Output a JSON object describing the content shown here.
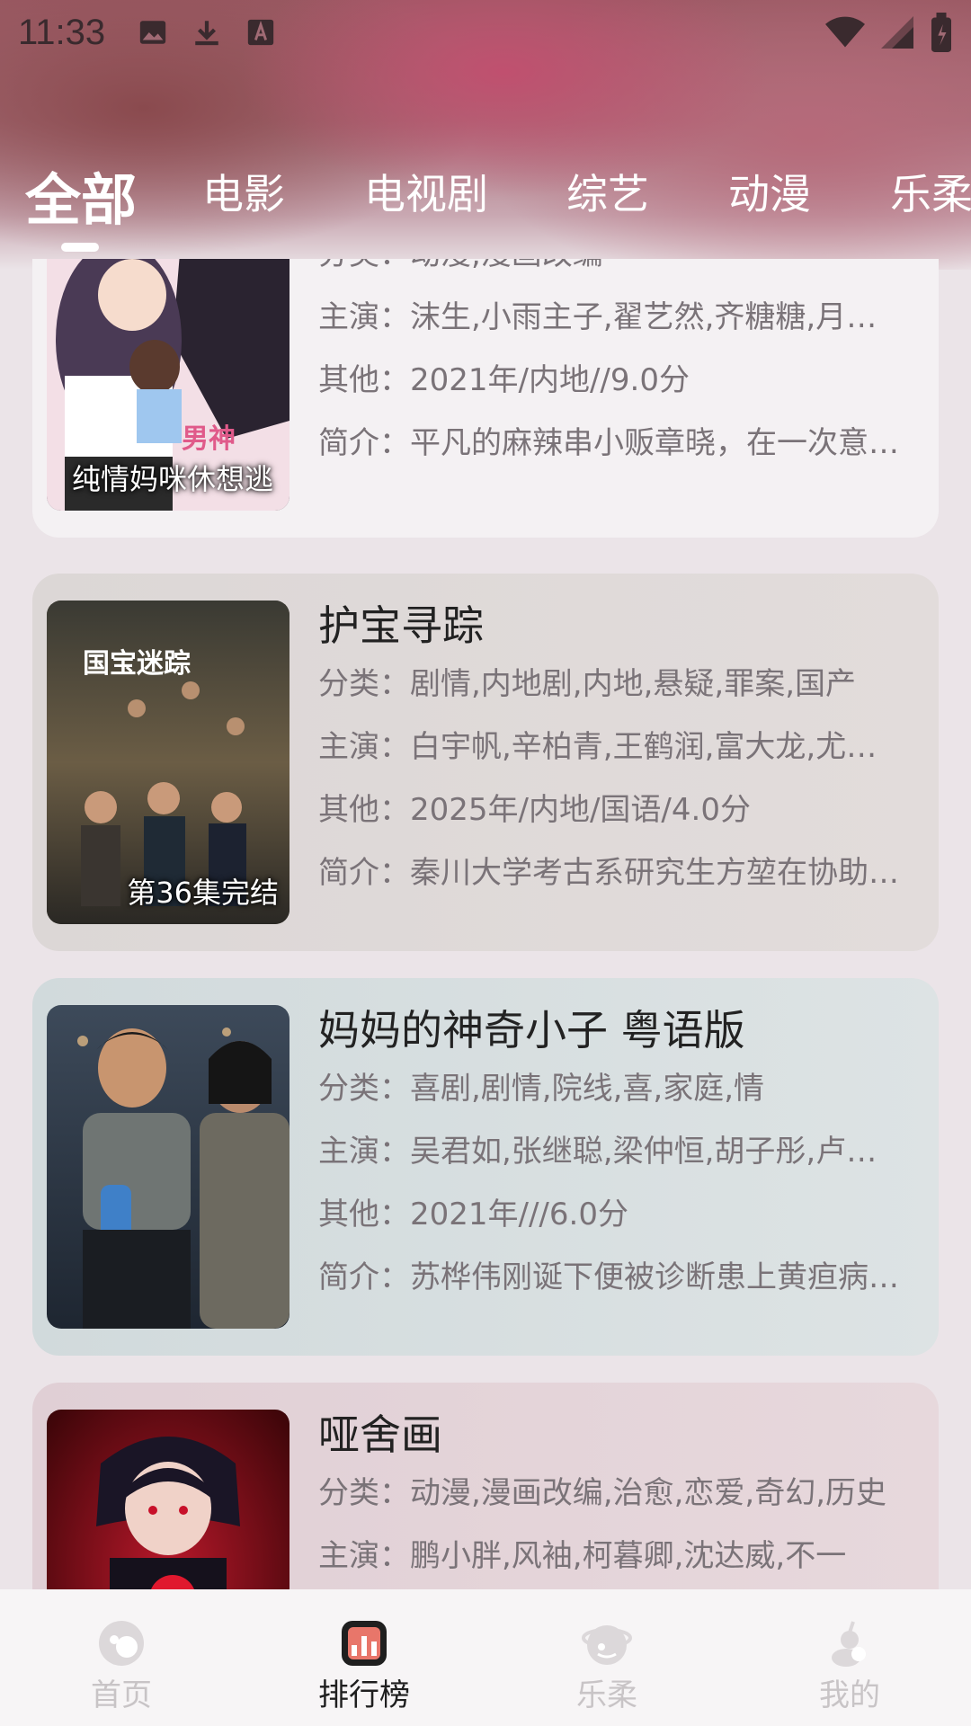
{
  "status_bar": {
    "time": "11:33",
    "icons_left": [
      "image-icon",
      "download-icon",
      "font-icon"
    ],
    "icons_right": [
      "wifi-icon",
      "signal-icon",
      "battery-icon"
    ]
  },
  "tabs": [
    {
      "label": "全部",
      "active": true
    },
    {
      "label": "电影",
      "active": false
    },
    {
      "label": "电视剧",
      "active": false
    },
    {
      "label": "综艺",
      "active": false
    },
    {
      "label": "动漫",
      "active": false
    },
    {
      "label": "乐柔",
      "active": false
    }
  ],
  "cards": [
    {
      "title": "",
      "poster_label": "纯情妈咪休想逃",
      "category_label": "分类：",
      "category": "动漫,漫画改编",
      "cast_label": "主演：",
      "cast": "沫生,小雨主子,翟艺然,齐糖糖,月…",
      "other_label": "其他：",
      "other": "2021年/内地//9.0分",
      "intro_label": "简介：",
      "intro": "平凡的麻辣串小贩章晓，在一次意…"
    },
    {
      "title": "护宝寻踪",
      "poster_label": "第36集完结",
      "poster_text": "国宝迷踪",
      "category_label": "分类：",
      "category": "剧情,内地剧,内地,悬疑,罪案,国产",
      "cast_label": "主演：",
      "cast": "白宇帆,辛柏青,王鹤润,富大龙,尤…",
      "other_label": "其他：",
      "other": "2025年/内地/国语/4.0分",
      "intro_label": "简介：",
      "intro": "秦川大学考古系研究生方堃在协助…"
    },
    {
      "title": "妈妈的神奇小子 粤语版",
      "poster_label": "",
      "category_label": "分类：",
      "category": "喜剧,剧情,院线,喜,家庭,情",
      "cast_label": "主演：",
      "cast": "吴君如,张继聪,梁仲恒,胡子彤,卢…",
      "other_label": "其他：",
      "other": "2021年///6.0分",
      "intro_label": "简介：",
      "intro": "苏桦伟刚诞下便被诊断患上黄疸病…"
    },
    {
      "title": "哑舍画",
      "poster_label": "",
      "category_label": "分类：",
      "category": "动漫,漫画改编,治愈,恋爱,奇幻,历史",
      "cast_label": "主演：",
      "cast": "鹏小胖,风袖,柯暮卿,沈达威,不一"
    }
  ],
  "bottom_nav": [
    {
      "label": "首页",
      "icon": "home-icon",
      "active": false
    },
    {
      "label": "排行榜",
      "icon": "ranking-icon",
      "active": true
    },
    {
      "label": "乐柔",
      "icon": "planet-icon",
      "active": false
    },
    {
      "label": "我的",
      "icon": "profile-icon",
      "active": false
    }
  ],
  "colors": {
    "active_nav": "#1f1f1f",
    "inactive_nav": "#c8c4c6",
    "ranking_icon": "#e8766a",
    "tab_text": "#ffffff"
  }
}
